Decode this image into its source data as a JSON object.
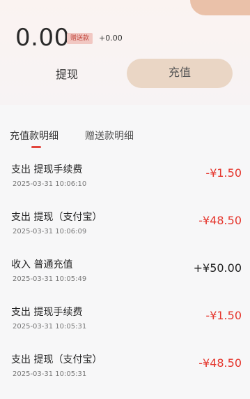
{
  "account": {
    "balance": "0.00",
    "gift_badge": "赠送款",
    "gift_amount": "+0.00"
  },
  "actions": {
    "withdraw": "提现",
    "recharge": "充值"
  },
  "tabs": [
    {
      "label": "充值款明细",
      "active": true
    },
    {
      "label": "赠送款明细",
      "active": false
    }
  ],
  "records": [
    {
      "title": "支出 提现手续费",
      "time": "2025-03-31 10:06:10",
      "amount": "-¥1.50",
      "type": "out"
    },
    {
      "title": "支出 提现（支付宝）",
      "time": "2025-03-31 10:06:09",
      "amount": "-¥48.50",
      "type": "out"
    },
    {
      "title": "收入 普通充值",
      "time": "2025-03-31 10:05:49",
      "amount": "+¥50.00",
      "type": "in"
    },
    {
      "title": "支出 提现手续费",
      "time": "2025-03-31 10:05:31",
      "amount": "-¥1.50",
      "type": "out"
    },
    {
      "title": "支出 提现（支付宝）",
      "time": "2025-03-31 10:05:31",
      "amount": "-¥48.50",
      "type": "out"
    }
  ],
  "colors": {
    "accent_red": "#e5352c",
    "recharge_button": "#ead6c5"
  }
}
